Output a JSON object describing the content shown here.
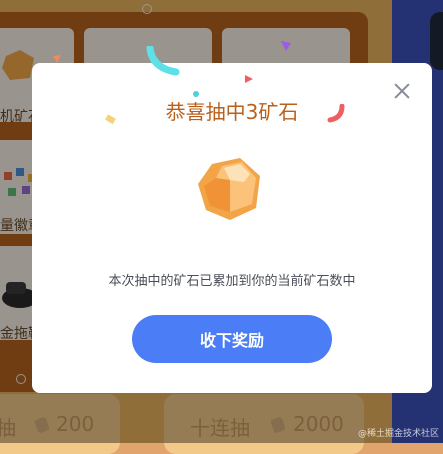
{
  "background": {
    "grid_labels": {
      "row1": "机矿石",
      "row2": "量徽章",
      "row3": "金拖鞋"
    },
    "single_draw": {
      "label": "抽",
      "cost": "200"
    },
    "ten_draw": {
      "label": "十连抽",
      "cost": "2000"
    }
  },
  "modal": {
    "title": "恭喜抽中3矿石",
    "prize_icon": "ore-rock-icon",
    "message": "本次抽中的矿石已累加到你的当前矿石数中",
    "accept_label": "收下奖励",
    "close_icon": "close-icon"
  },
  "watermark": "@稀土掘金技术社区",
  "colors": {
    "title": "#b9601b",
    "button": "#4a7df6",
    "board": "#b5611c"
  }
}
